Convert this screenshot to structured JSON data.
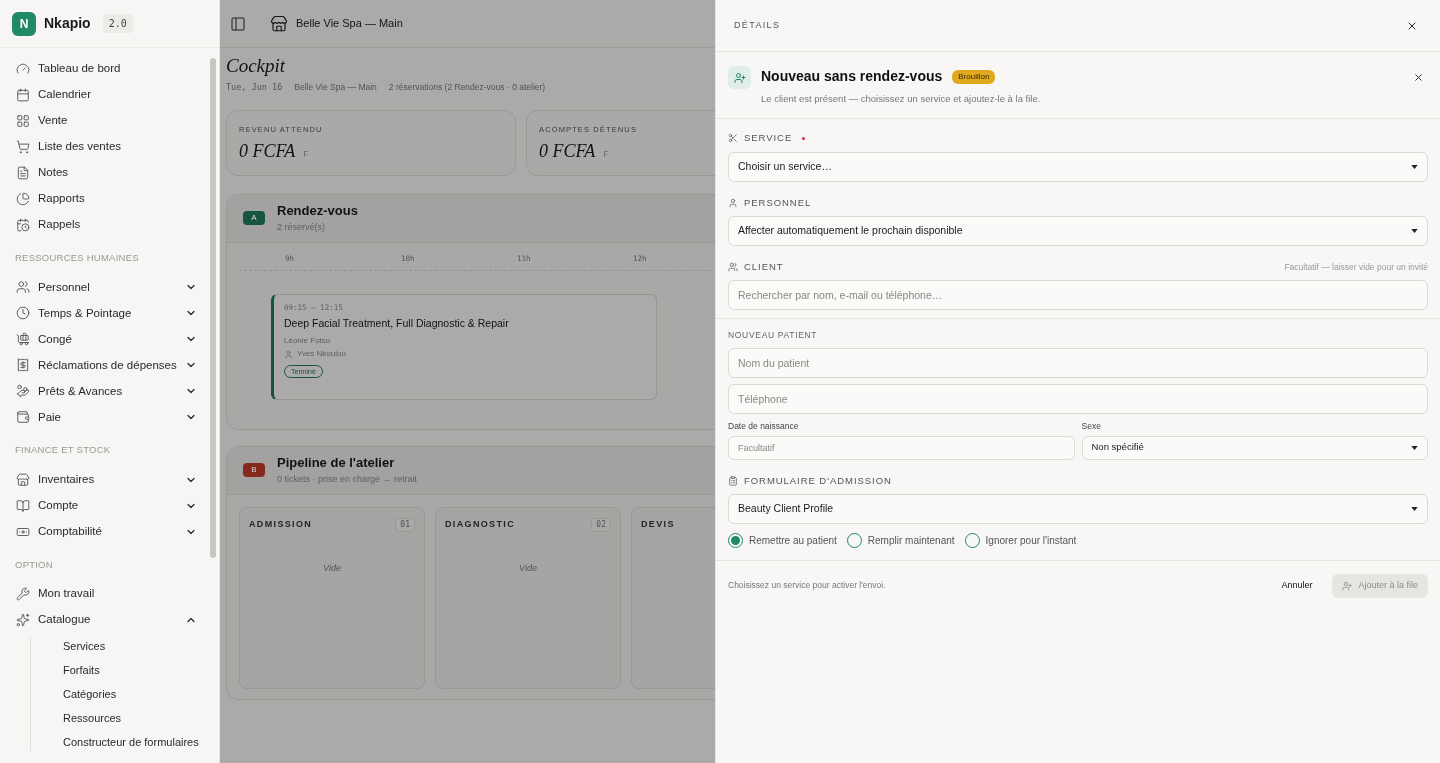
{
  "sidebar": {
    "brand": {
      "initial": "N",
      "name": "Nkapio",
      "version": "2.0"
    },
    "items": [
      {
        "kind": "link",
        "label": "Tableau de bord"
      },
      {
        "kind": "link",
        "label": "Calendrier"
      },
      {
        "kind": "link",
        "label": "Vente"
      },
      {
        "kind": "link",
        "label": "Liste des ventes"
      },
      {
        "kind": "link",
        "label": "Notes"
      },
      {
        "kind": "link",
        "label": "Rapports"
      },
      {
        "kind": "link",
        "label": "Rappels"
      }
    ],
    "sections": [
      {
        "title": "RESSOURCES HUMAINES",
        "items": [
          {
            "kind": "group",
            "label": "Personnel",
            "expanded": false
          },
          {
            "kind": "group",
            "label": "Temps & Pointage",
            "expanded": false
          },
          {
            "kind": "group",
            "label": "Congé",
            "expanded": false
          },
          {
            "kind": "group",
            "label": "Réclamations de dépenses",
            "expanded": false
          },
          {
            "kind": "group",
            "label": "Prêts & Avances",
            "expanded": false
          },
          {
            "kind": "group",
            "label": "Paie",
            "expanded": false
          }
        ]
      },
      {
        "title": "FINANCE ET STOCK",
        "items": [
          {
            "kind": "group",
            "label": "Inventaires",
            "expanded": false
          },
          {
            "kind": "group",
            "label": "Compte",
            "expanded": false
          },
          {
            "kind": "group",
            "label": "Comptabilité",
            "expanded": false
          }
        ]
      },
      {
        "title": "OPTION",
        "items": [
          {
            "kind": "link",
            "label": "Mon travail"
          },
          {
            "kind": "group",
            "label": "Catalogue",
            "expanded": true,
            "children": [
              "Services",
              "Forfaits",
              "Catégories",
              "Ressources",
              "Constructeur de formulaires"
            ]
          }
        ]
      }
    ]
  },
  "topbar": {
    "store": "Belle Vie Spa — Main"
  },
  "page": {
    "title": "Cockpit",
    "meta": [
      "Tue, Jun 16",
      "Belle Vie Spa — Main",
      "2 réservations (2 Rendez-vous · 0 atelier)"
    ],
    "stats": [
      {
        "label": "REVENU ATTENDU",
        "value": "0 FCFA",
        "unit": "F"
      },
      {
        "label": "ACOMPTES DÉTENUS",
        "value": "0 FCFA",
        "unit": "F"
      }
    ],
    "appointments": {
      "badge": "A",
      "color": "#16553f",
      "title": "Rendez-vous",
      "subtitle": "2 réservé(s)",
      "hours": [
        "9h",
        "10h",
        "11h",
        "12h"
      ],
      "card": {
        "time": "09:15 — 12:15",
        "title": "Deep Facial Treatment, Full Diagnostic & Repair",
        "client": "Léonie Fotso",
        "staff": "Yves Nkoulou",
        "status": "Terminé"
      }
    },
    "pipeline": {
      "badge": "B",
      "color": "#86281e",
      "title": "Pipeline de l'atelier",
      "subtitle": "0 tickets · prise en charge → retrait",
      "columns": [
        {
          "title": "ADMISSION",
          "count": "01",
          "empty": "Vide"
        },
        {
          "title": "DIAGNOSTIC",
          "count": "02",
          "empty": "Vide"
        },
        {
          "title": "DEVIS"
        }
      ]
    }
  },
  "drawer": {
    "title": "DÉTAILS",
    "form": {
      "title": "Nouveau sans rendez-vous",
      "badge": "Brouillon",
      "subtitle": "Le client est présent — choisissez un service et ajoutez-le à la file.",
      "service": {
        "label": "SERVICE",
        "required": true,
        "value": "Choisir un service…"
      },
      "staff": {
        "label": "PERSONNEL",
        "value": "Affecter automatiquement le prochain disponible"
      },
      "client": {
        "label": "CLIENT",
        "hint": "Facultatif — laisser vide pour un invité",
        "placeholder": "Rechercher par nom, e-mail ou téléphone…"
      },
      "new_patient": {
        "title": "NOUVEAU PATIENT",
        "name_placeholder": "Nom du patient",
        "phone_placeholder": "Téléphone",
        "birth_label": "Date de naissance",
        "birth_placeholder": "Facultatif",
        "sex_label": "Sexe",
        "sex_value": "Non spécifié"
      },
      "intake": {
        "label": "FORMULAIRE D'ADMISSION",
        "value": "Beauty Client Profile",
        "options": [
          {
            "label": "Remettre au patient",
            "selected": true
          },
          {
            "label": "Remplir maintenant",
            "selected": false
          },
          {
            "label": "Ignorer pour l'instant",
            "selected": false
          }
        ]
      },
      "footer": {
        "hint": "Choisissez un service pour activer l'envoi.",
        "cancel": "Annuler",
        "submit": {
          "label": "Ajouter à la file",
          "disabled": true
        }
      }
    }
  }
}
